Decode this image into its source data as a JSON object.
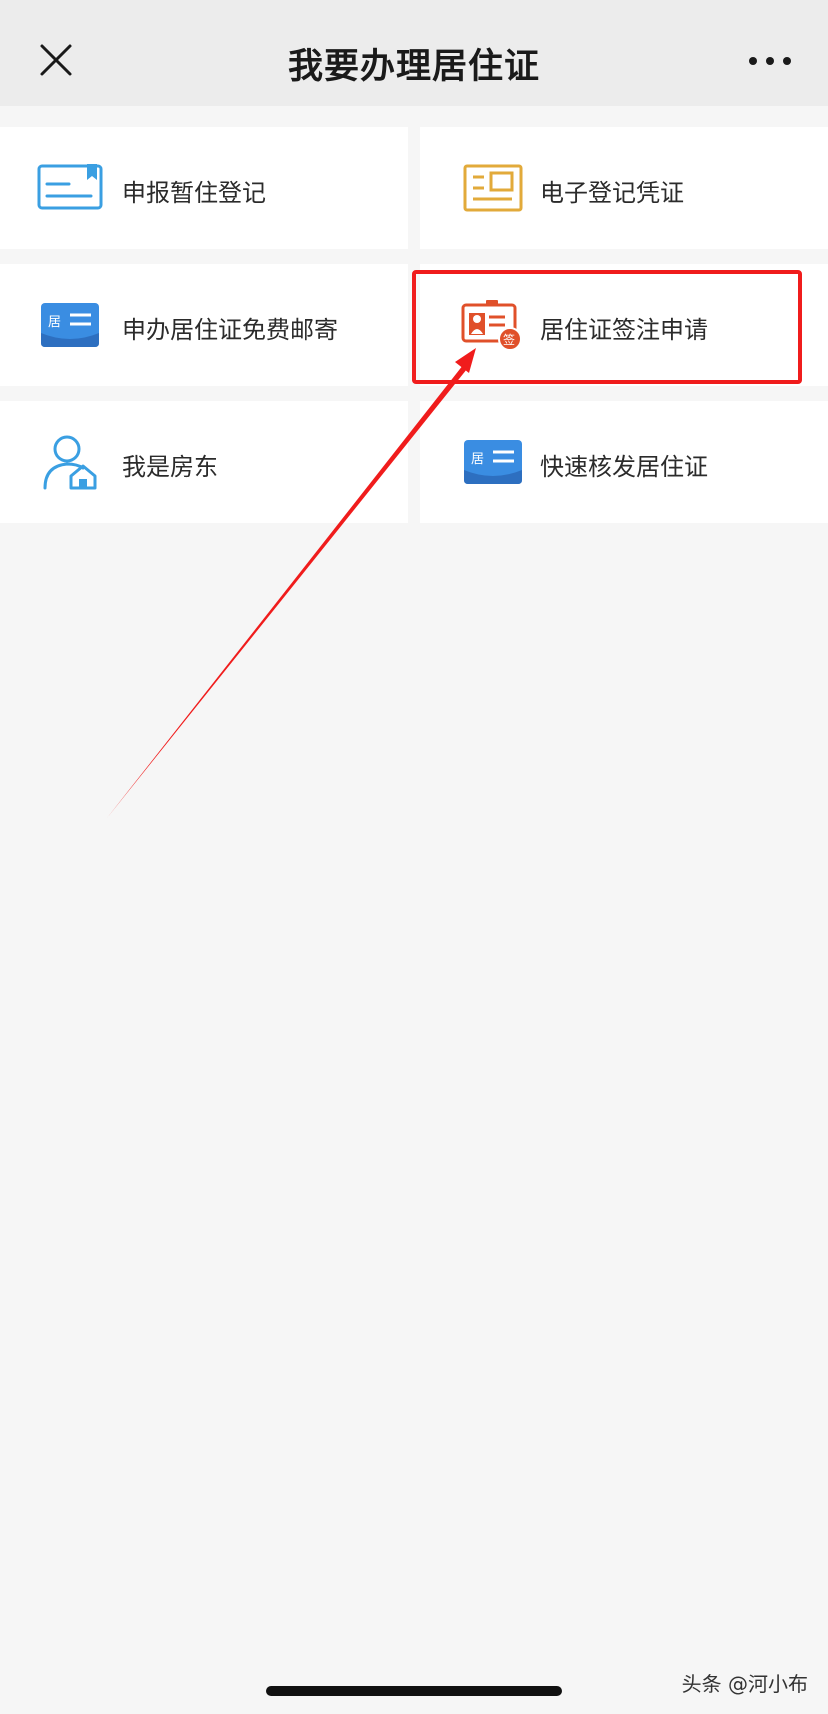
{
  "header": {
    "title": "我要办理居住证",
    "close_icon": "close-icon",
    "more_icon": "more-icon"
  },
  "services": [
    {
      "label": "申报暂住登记",
      "icon": "registration-card-icon",
      "color": "#3a9fe2"
    },
    {
      "label": "电子登记凭证",
      "icon": "electronic-voucher-icon",
      "color": "#e2aa3a"
    },
    {
      "label": "申办居住证免费邮寄",
      "icon": "residence-card-mail-icon",
      "color": "#3a8de2"
    },
    {
      "label": "居住证签注申请",
      "icon": "residence-endorsement-icon",
      "color": "#e0502a"
    },
    {
      "label": "我是房东",
      "icon": "landlord-icon",
      "color": "#3a9fe2"
    },
    {
      "label": "快速核发居住证",
      "icon": "quick-residence-card-icon",
      "color": "#3a8de2"
    }
  ],
  "icon_text": {
    "ju": "居",
    "qian": "签"
  },
  "annotation": {
    "highlight_color": "#f01c1c"
  },
  "watermark": "头条 @河小布"
}
